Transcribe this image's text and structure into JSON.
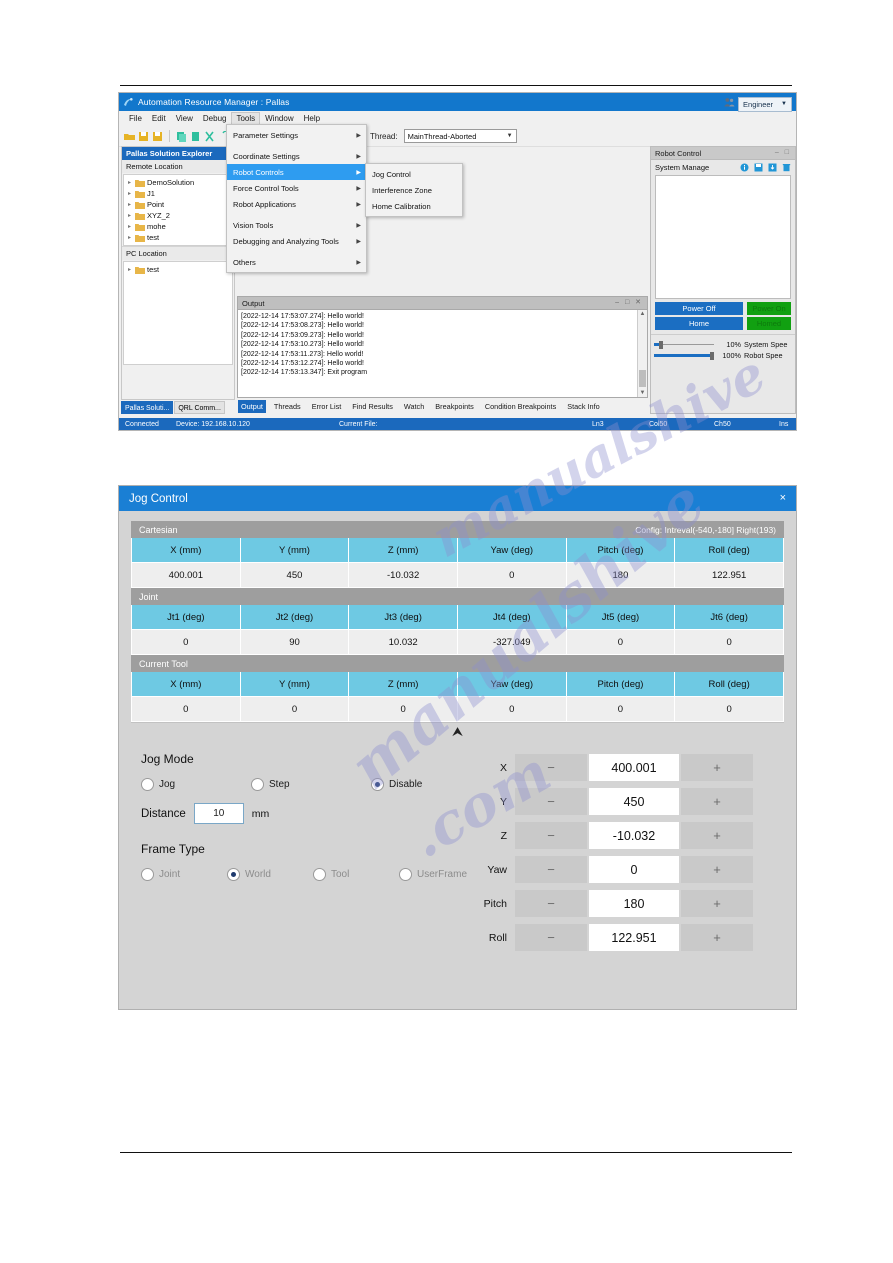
{
  "arm_window": {
    "title": "Automation Resource Manager : Pallas",
    "icon": "app-icon",
    "window_buttons": [
      "minimize",
      "maximize",
      "close"
    ],
    "menubar": [
      "File",
      "Edit",
      "View",
      "Debug",
      "Tools",
      "Window",
      "Help"
    ],
    "menubar_active": "Tools",
    "toolbar": {
      "thread_label": "Thread:",
      "thread_value": "MainThread-Aborted",
      "user_value": "Engineer"
    },
    "explorer": {
      "header": "Pallas Solution Explorer",
      "remote_label": "Remote Location",
      "remote_items": [
        "DemoSolution",
        "J1",
        "Point",
        "XYZ_2",
        "mohe",
        "test"
      ],
      "pc_label": "PC Location",
      "pc_items": [
        "test"
      ],
      "tabs": [
        "Pallas Soluti...",
        "QRL Comm..."
      ],
      "selected_tab": "Pallas Soluti..."
    },
    "output": {
      "header": "Output",
      "lines": [
        "[2022-12-14 17:53:07.274]: Hello world!",
        "[2022-12-14 17:53:08.273]: Hello world!",
        "[2022-12-14 17:53:09.273]: Hello world!",
        "[2022-12-14 17:53:10.273]: Hello world!",
        "[2022-12-14 17:53:11.273]: Hello world!",
        "[2022-12-14 17:53:12.274]: Hello world!",
        "[2022-12-14 17:53:13.347]: Exit program"
      ],
      "tabs": [
        "Output",
        "Threads",
        "Error List",
        "Find Results",
        "Watch",
        "Breakpoints",
        "Condition Breakpoints",
        "Stack Info"
      ],
      "selected_tab": "Output"
    },
    "robot_control": {
      "header": "Robot Control",
      "system_manage": "System Manage",
      "icons": [
        "info-icon",
        "save-icon",
        "export-icon",
        "delete-icon"
      ],
      "power_button": "Power Off",
      "power_status": "Power On",
      "home_button": "Home",
      "home_status": "Homed",
      "system_speed_pct": "10%",
      "system_speed_label": "System Spee",
      "robot_speed_pct": "100%",
      "robot_speed_label": "Robot Spee"
    },
    "statusbar": {
      "connection": "Connected",
      "device": "Device: 192.168.10.120",
      "current_file": "Current File:",
      "ln": "Ln3",
      "col": "Col50",
      "ch": "Ch50",
      "ins": "Ins"
    },
    "menu_tools": [
      {
        "label": "Parameter Settings",
        "submenu": true,
        "highlighted": false
      },
      {
        "label": "__sep__",
        "submenu": false,
        "highlighted": false
      },
      {
        "label": "Coordinate Settings",
        "submenu": true,
        "highlighted": false
      },
      {
        "label": "Robot Controls",
        "submenu": true,
        "highlighted": true
      },
      {
        "label": "Force Control Tools",
        "submenu": true,
        "highlighted": false
      },
      {
        "label": "Robot Applications",
        "submenu": true,
        "highlighted": false
      },
      {
        "label": "__sep__",
        "submenu": false,
        "highlighted": false
      },
      {
        "label": "Vision Tools",
        "submenu": true,
        "highlighted": false
      },
      {
        "label": "Debugging and Analyzing Tools",
        "submenu": true,
        "highlighted": false
      },
      {
        "label": "__sep__",
        "submenu": false,
        "highlighted": false
      },
      {
        "label": "Others",
        "submenu": true,
        "highlighted": false
      }
    ],
    "menu_robot_controls": [
      "Jog Control",
      "Interference Zone",
      "Home Calibration"
    ]
  },
  "jog_dialog": {
    "title": "Jog Control",
    "close_label": "×",
    "cartesian": {
      "section_title": "Cartesian",
      "config": "Config: Intreval(-540,-180]  Right(193)",
      "headers": [
        "X (mm)",
        "Y (mm)",
        "Z (mm)",
        "Yaw (deg)",
        "Pitch (deg)",
        "Roll (deg)"
      ],
      "values": [
        "400.001",
        "450",
        "-10.032",
        "0",
        "180",
        "122.951"
      ]
    },
    "joint": {
      "section_title": "Joint",
      "headers": [
        "Jt1 (deg)",
        "Jt2 (deg)",
        "Jt3 (deg)",
        "Jt4 (deg)",
        "Jt5 (deg)",
        "Jt6 (deg)"
      ],
      "values": [
        "0",
        "90",
        "10.032",
        "-327.049",
        "0",
        "0"
      ]
    },
    "current_tool": {
      "section_title": "Current Tool",
      "headers": [
        "X (mm)",
        "Y (mm)",
        "Z (mm)",
        "Yaw (deg)",
        "Pitch (deg)",
        "Roll (deg)"
      ],
      "values": [
        "0",
        "0",
        "0",
        "0",
        "0",
        "0"
      ]
    },
    "collapse_icon": "chevron-double-up-icon",
    "jog_mode": {
      "title": "Jog Mode",
      "options": [
        {
          "label": "Jog",
          "selected": false
        },
        {
          "label": "Step",
          "selected": false
        },
        {
          "label": "Disable",
          "selected": true
        }
      ],
      "distance_label": "Distance",
      "distance_value": "10",
      "distance_unit": "mm"
    },
    "frame_type": {
      "title": "Frame Type",
      "options": [
        {
          "label": "Joint",
          "selected": false,
          "disabled": true
        },
        {
          "label": "World",
          "selected": true,
          "disabled": true
        },
        {
          "label": "Tool",
          "selected": false,
          "disabled": true
        },
        {
          "label": "UserFrame",
          "selected": false,
          "disabled": true
        }
      ]
    },
    "axes": [
      {
        "label": "X",
        "value": "400.001",
        "minus": "−",
        "plus": "+"
      },
      {
        "label": "Y",
        "value": "450",
        "minus": "−",
        "plus": "+"
      },
      {
        "label": "Z",
        "value": "-10.032",
        "minus": "−",
        "plus": "+"
      },
      {
        "label": "Yaw",
        "value": "0",
        "minus": "−",
        "plus": "+"
      },
      {
        "label": "Pitch",
        "value": "180",
        "minus": "−",
        "plus": "+"
      },
      {
        "label": "Roll",
        "value": "122.951",
        "minus": "−",
        "plus": "+"
      }
    ]
  },
  "watermark": {
    "l1": "manualshive",
    "l2": "manualshive",
    "l3": ".com"
  },
  "colors": {
    "titlebar_blue": "#1277cc",
    "dialog_blue": "#1a7fd4",
    "accent_header": "#6ec9e3",
    "section_gray": "#9e9e9e",
    "status_blue": "#1b69bd",
    "button_blue": "#1b6ec2",
    "status_green": "#11a011",
    "menu_highlight": "#2e9cf0"
  }
}
